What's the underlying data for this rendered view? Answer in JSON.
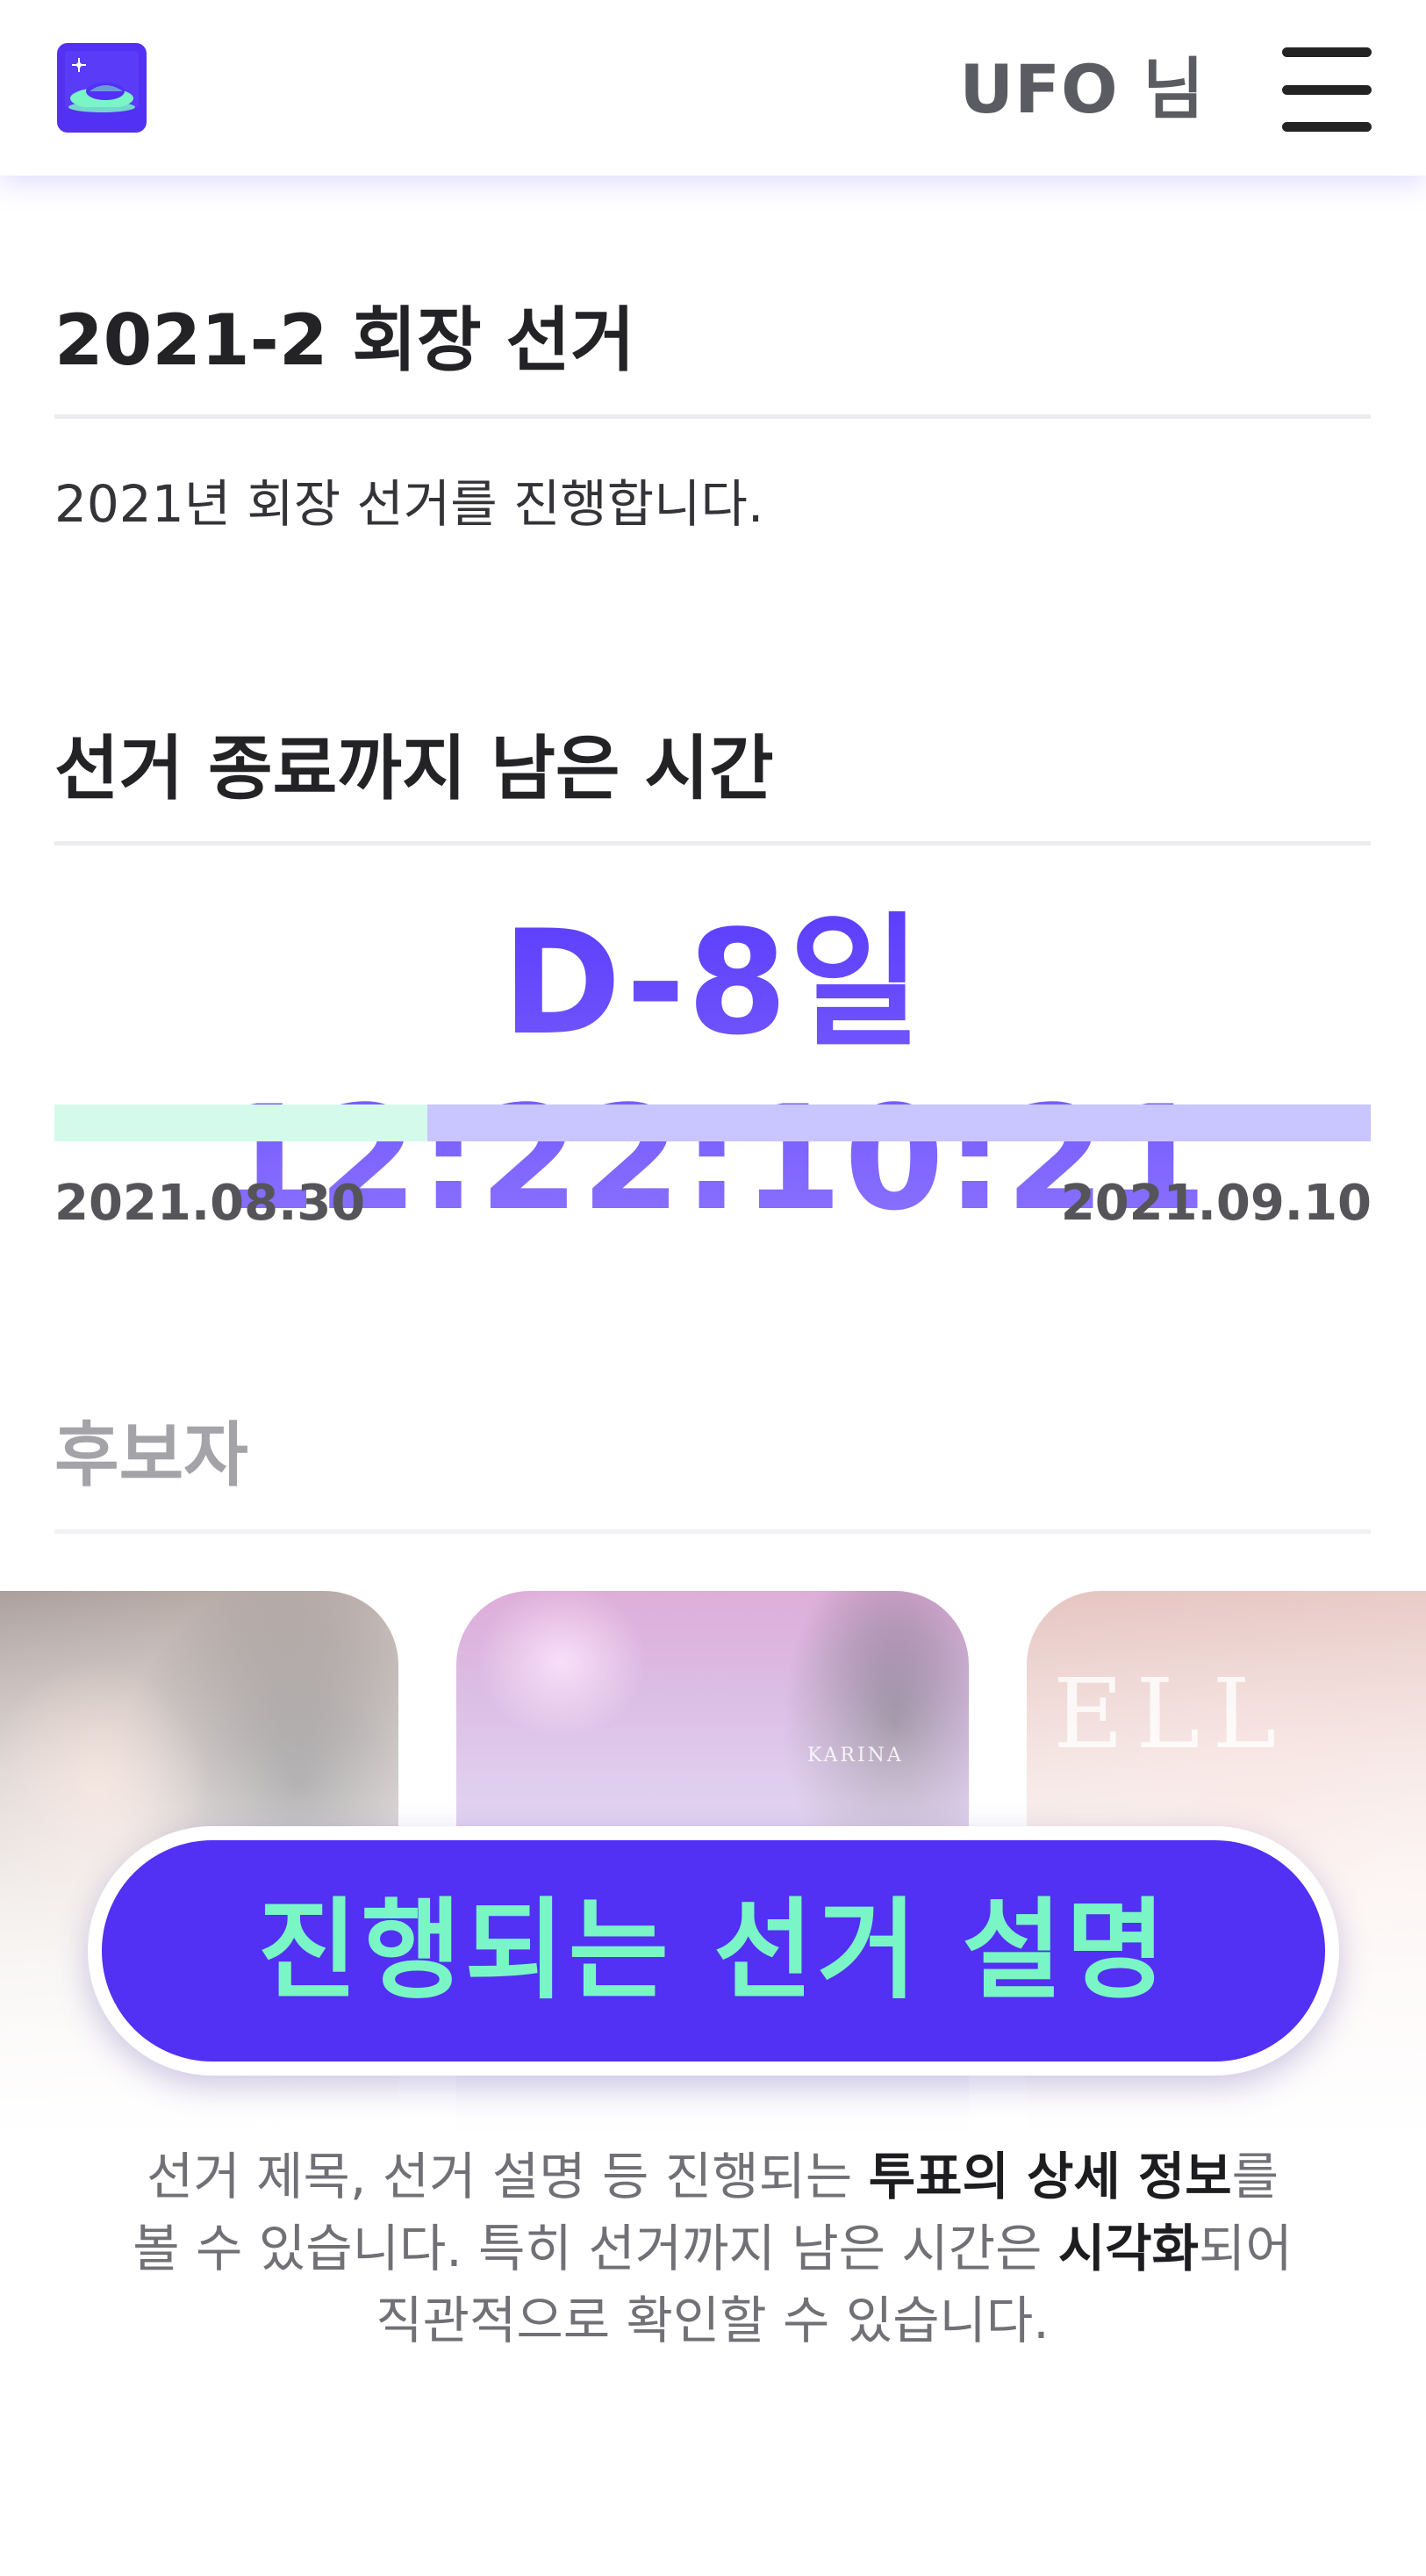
{
  "header": {
    "logo_icon": "ufo-logo-icon",
    "user_name": "UFO 님",
    "menu_icon": "hamburger-menu-icon"
  },
  "election": {
    "title": "2021-2 회장 선거",
    "description": "2021년 회장 선거를 진행합니다."
  },
  "countdown": {
    "title": "선거 종료까지 남은 시간",
    "value": "D-8일 12:22:10:21",
    "start_date": "2021.08.30",
    "end_date": "2021.09.10",
    "elapsed_fraction": 0.283
  },
  "candidates": {
    "title": "후보자",
    "cards": [
      {
        "label": ""
      },
      {
        "label": "KARINA"
      },
      {
        "label": "ELL"
      }
    ]
  },
  "cta": {
    "label": "진행되는 선거 설명"
  },
  "explanation": {
    "line1_a": "선거 제목, 선거 설명 등 진행되는 ",
    "line1_b": "투표의 상세 정보",
    "line1_c": "를",
    "line2_a": "볼 수 있습니다. 특히 선거까지 남은 시간은 ",
    "line2_b": "시각화",
    "line2_c": "되어",
    "line3": "직관적으로 확인할 수 있습니다."
  },
  "colors": {
    "brand": "#5230f4",
    "accent": "#7af5c6",
    "countdown": "#6b4dff",
    "progress_track": "#c9c5fe",
    "progress_fill": "#d4faec"
  }
}
